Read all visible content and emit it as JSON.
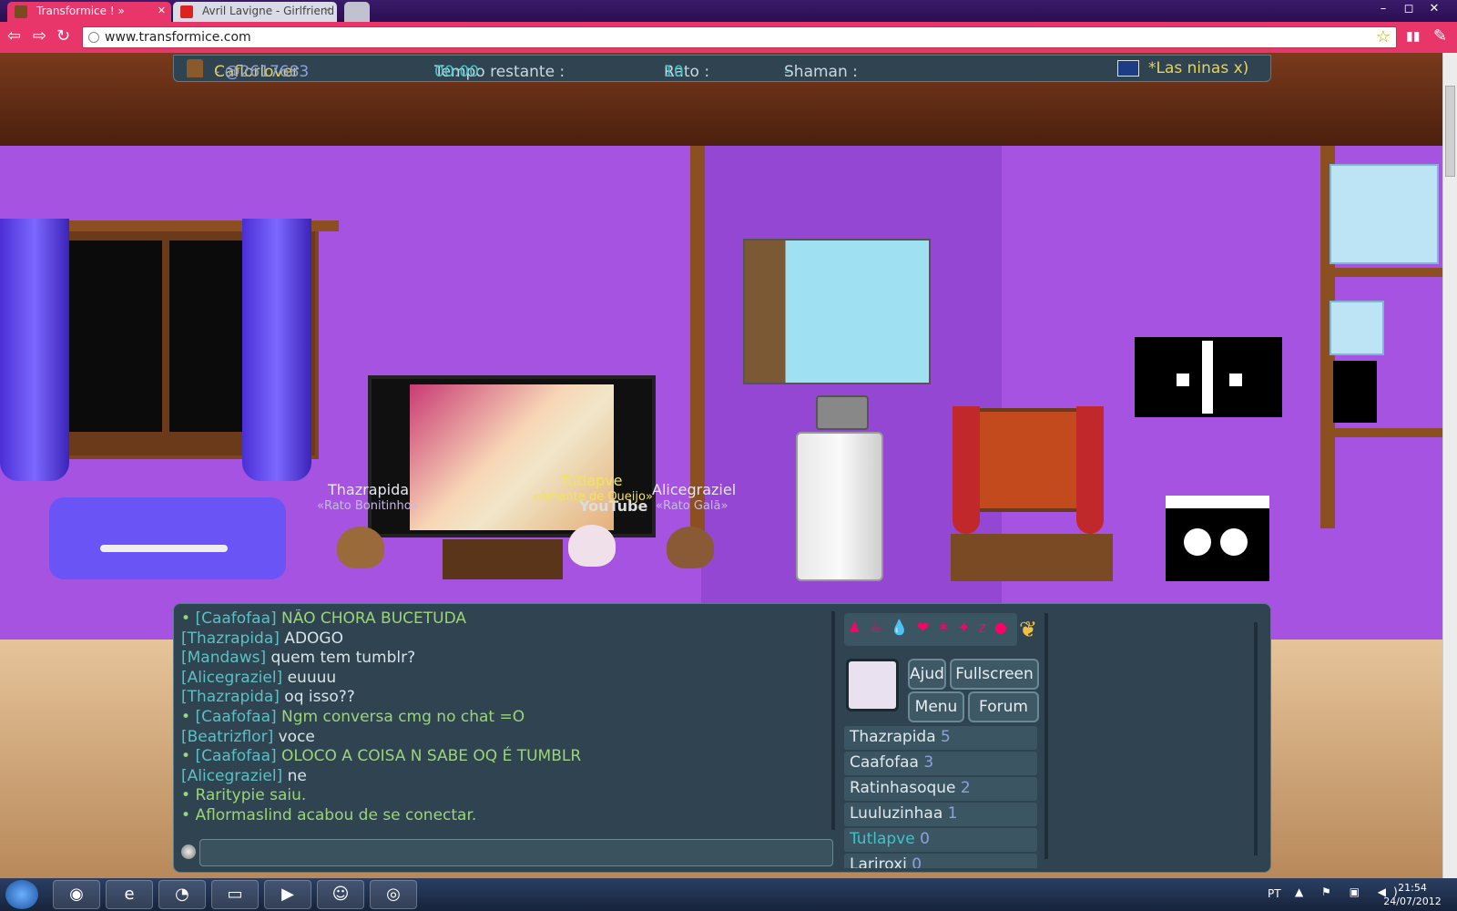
{
  "browser": {
    "tabs": [
      {
        "title": "Transformice ! »",
        "active": true
      },
      {
        "title": "Avril Lavigne - Girlfriend (",
        "active": false
      }
    ],
    "url": "www.transformice.com",
    "window_controls": {
      "minimize": "–",
      "maximize": "◻",
      "close": "✕"
    }
  },
  "hud": {
    "player_name": "Caflorlover",
    "room_code": " - @2617683",
    "time_label": "Tempo restante : ",
    "time_value": "00:00",
    "rato_label": "Rato : ",
    "rato_value": "10",
    "shaman_label": "Shaman : ",
    "shaman_value": "-",
    "tribe_name": "*Las ninas x)"
  },
  "mice": [
    {
      "name": "Thazrapida",
      "title": "«Rato Bonitinho»"
    },
    {
      "name": "Tutlapve",
      "title": "«Amante de Queijo»"
    },
    {
      "name": "Alicegraziel",
      "title": "«Rato Galã»"
    }
  ],
  "tv": {
    "overlay": "YouTube"
  },
  "chat": {
    "lines": [
      {
        "bullet": "• ",
        "author": "[Caafofaa]",
        "text": " NÃO CHORA BUCETUDA"
      },
      {
        "bullet": "",
        "author": "[Thazrapida]",
        "text": " ADOGO"
      },
      {
        "bullet": "",
        "author": "[Mandaws]",
        "text": " quem tem tumblr?"
      },
      {
        "bullet": "",
        "author": "[Alicegraziel]",
        "text": " euuuu"
      },
      {
        "bullet": "",
        "author": "[Thazrapida]",
        "text": " oq isso??"
      },
      {
        "bullet": "• ",
        "author": "[Caafofaa]",
        "text": " Ngm conversa cmg no chat =O"
      },
      {
        "bullet": "",
        "author": "[Beatrizflor]",
        "text": " voce"
      },
      {
        "bullet": "• ",
        "author": "[Caafofaa]",
        "text": " OLOCO A COISA N SABE OQ É TUMBLR"
      },
      {
        "bullet": "",
        "author": "[Alicegraziel]",
        "text": " ne"
      },
      {
        "bullet": "• ",
        "author": "",
        "text": "Raritypie saiu."
      },
      {
        "bullet": "• ",
        "author": "",
        "text": "Aflormaslind acabou de se conectar."
      }
    ],
    "input_value": ""
  },
  "panel": {
    "emotes": "♟ ☕ 💧 ❤ ✶ ✦ z ●",
    "buttons": {
      "help": "Ajud",
      "fullscreen": "Fullscreen",
      "menu": "Menu",
      "forum": "Forum"
    },
    "players": [
      {
        "name": "Thazrapida",
        "score": "5"
      },
      {
        "name": "Caafofaa",
        "score": "3"
      },
      {
        "name": "Ratinhasoque",
        "score": "2"
      },
      {
        "name": "Luuluzinhaa",
        "score": "1"
      },
      {
        "name": "Tutlapve",
        "score": "0",
        "me": true
      },
      {
        "name": "Lariroxi",
        "score": "0"
      }
    ]
  },
  "taskbar": {
    "apps": [
      {
        "name": "chrome-icon",
        "glyph": "◉"
      },
      {
        "name": "ie-icon",
        "glyph": "e"
      },
      {
        "name": "firefox-icon",
        "glyph": "◔"
      },
      {
        "name": "explorer-icon",
        "glyph": "▭"
      },
      {
        "name": "media-player-icon",
        "glyph": "▶"
      },
      {
        "name": "messenger-icon",
        "glyph": "☺"
      },
      {
        "name": "chrome-window-icon",
        "glyph": "◎"
      }
    ],
    "language": "PT",
    "tray": "▲ ⚑ ▣ ◀)",
    "time": "21:54",
    "date": "24/07/2012"
  }
}
